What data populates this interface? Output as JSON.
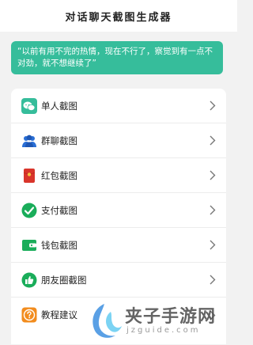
{
  "header": {
    "title": "对话聊天截图生成器"
  },
  "banner": {
    "text": "“以前有用不完的热情，现在不行了，察觉到有一点不对劲，就不想继续了”"
  },
  "menu": {
    "items": [
      {
        "label": "单人截图",
        "icon": "wechat-icon"
      },
      {
        "label": "群聊截图",
        "icon": "group-icon"
      },
      {
        "label": "红包截图",
        "icon": "red-envelope-icon"
      },
      {
        "label": "支付截图",
        "icon": "payment-check-icon"
      },
      {
        "label": "钱包截图",
        "icon": "wallet-icon"
      },
      {
        "label": "朋友圈截图",
        "icon": "thumbs-up-icon"
      },
      {
        "label": "教程建议",
        "icon": "question-icon"
      }
    ]
  },
  "watermark": {
    "text": "夹子手游网",
    "sub": "jzguide.com"
  },
  "colors": {
    "accent": "#36bd9b",
    "background": "#f2f2f2"
  }
}
